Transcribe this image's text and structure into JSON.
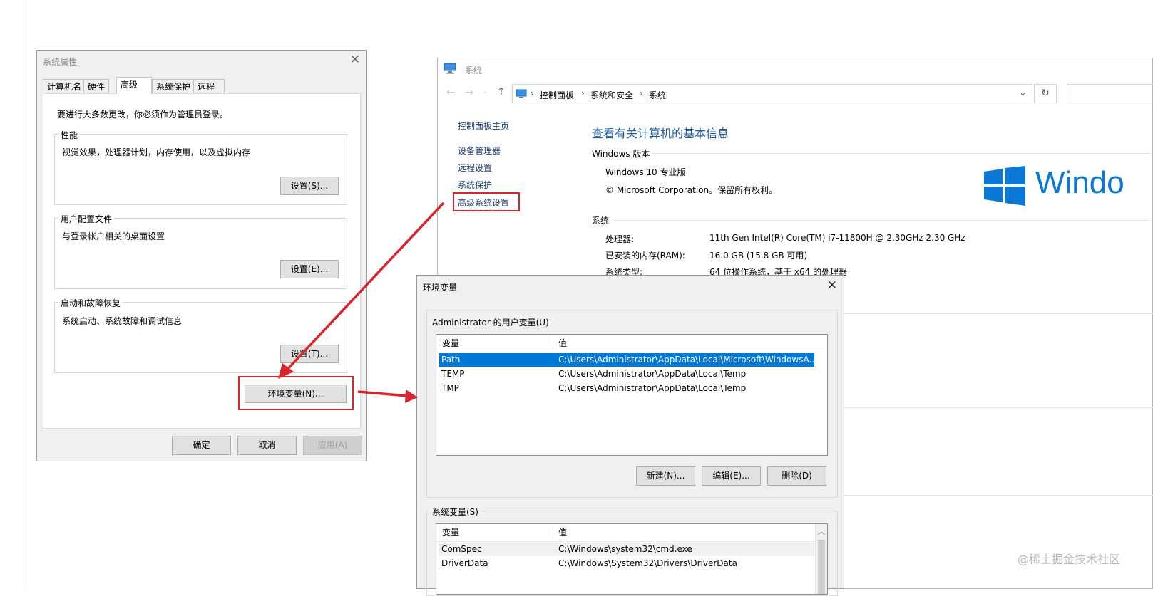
{
  "system_properties": {
    "title": "系统属性",
    "tabs": [
      "计算机名",
      "硬件",
      "高级",
      "系统保护",
      "远程"
    ],
    "admin_note": "要进行大多数更改，你必须作为管理员登录。",
    "performance": {
      "label": "性能",
      "desc": "视觉效果，处理器计划，内存使用，以及虚拟内存",
      "button": "设置(S)..."
    },
    "user_profiles": {
      "label": "用户配置文件",
      "desc": "与登录帐户相关的桌面设置",
      "button": "设置(E)..."
    },
    "startup_recovery": {
      "label": "启动和故障恢复",
      "desc": "系统启动、系统故障和调试信息",
      "button": "设置(T)..."
    },
    "env_button": "环境变量(N)...",
    "ok": "确定",
    "cancel": "取消",
    "apply": "应用(A)"
  },
  "system_window": {
    "title": "系统",
    "breadcrumb": [
      "控制面板",
      "系统和安全",
      "系统"
    ],
    "sidebar": [
      "控制面板主页",
      "设备管理器",
      "远程设置",
      "系统保护",
      "高级系统设置"
    ],
    "heading": "查看有关计算机的基本信息",
    "windows_section": "Windows 版本",
    "edition": "Windows 10 专业版",
    "copyright": "© Microsoft Corporation。保留所有权利。",
    "logo_text": "Windo",
    "system_section": "系统",
    "specs": [
      {
        "k": "处理器:",
        "v": "11th Gen Intel(R) Core(TM) i7-11800H @ 2.30GHz   2.30 GHz"
      },
      {
        "k": "已安装的内存(RAM):",
        "v": "16.0 GB (15.8 GB 可用)"
      },
      {
        "k": "系统类型:",
        "v": "64 位操作系统，基于 x64 的处理器"
      }
    ]
  },
  "env_vars": {
    "title": "环境变量",
    "user_section": "Administrator 的用户变量(U)",
    "col_var": "变量",
    "col_val": "值",
    "user_rows": [
      {
        "name": "Path",
        "value": "C:\\Users\\Administrator\\AppData\\Local\\Microsoft\\WindowsA..."
      },
      {
        "name": "TEMP",
        "value": "C:\\Users\\Administrator\\AppData\\Local\\Temp"
      },
      {
        "name": "TMP",
        "value": "C:\\Users\\Administrator\\AppData\\Local\\Temp"
      }
    ],
    "new_btn": "新建(N)...",
    "edit_btn": "编辑(E)...",
    "delete_btn": "删除(D)",
    "system_section": "系统变量(S)",
    "system_rows": [
      {
        "name": "ComSpec",
        "value": "C:\\Windows\\system32\\cmd.exe"
      },
      {
        "name": "DriverData",
        "value": "C:\\Windows\\System32\\Drivers\\DriverData"
      }
    ]
  },
  "watermark": "@稀土掘金技术社区",
  "colors": {
    "highlight": "#d9262c",
    "selection": "#0078d7",
    "windows_blue": "#0a78d4",
    "link": "#1f3f6b"
  }
}
